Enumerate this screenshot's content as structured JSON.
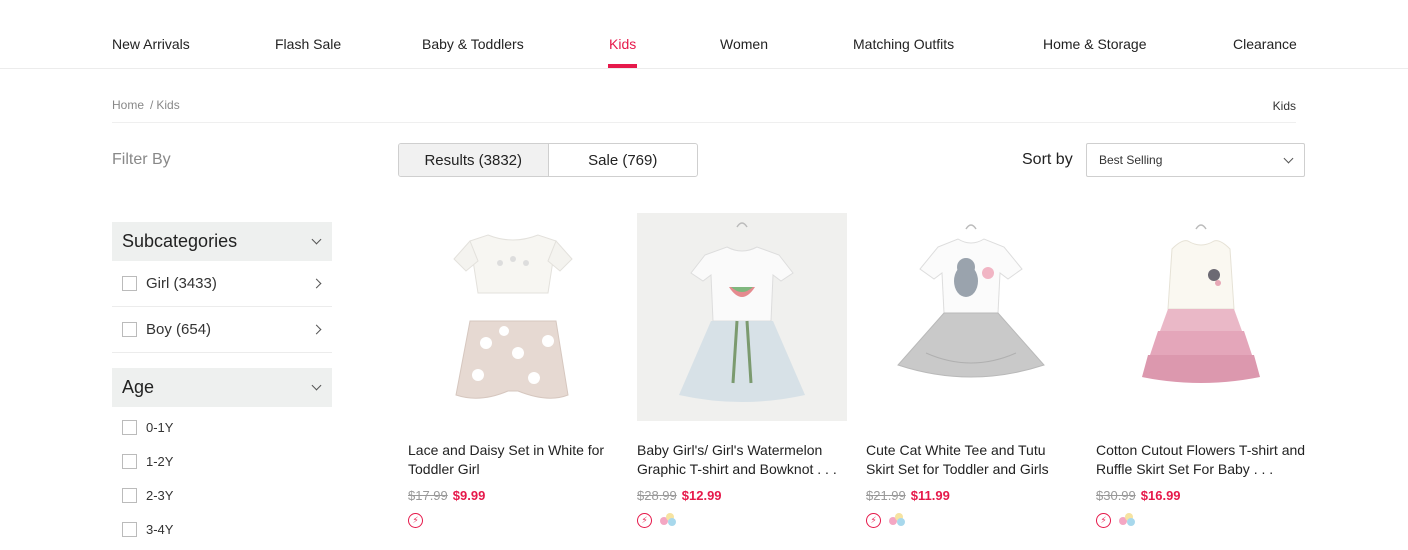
{
  "nav": {
    "items": [
      {
        "label": "New Arrivals"
      },
      {
        "label": "Flash Sale"
      },
      {
        "label": "Baby & Toddlers"
      },
      {
        "label": "Kids",
        "active": true
      },
      {
        "label": "Women"
      },
      {
        "label": "Matching Outfits"
      },
      {
        "label": "Home & Storage"
      },
      {
        "label": "Clearance"
      }
    ]
  },
  "breadcrumb": {
    "home": "Home",
    "separator": "/",
    "current": "Kids",
    "right_label": "Kids"
  },
  "filter_label": "Filter By",
  "tabs": [
    {
      "label": "Results (3832)",
      "active": true
    },
    {
      "label": "Sale (769)"
    }
  ],
  "sort": {
    "label": "Sort by",
    "selected": "Best Selling"
  },
  "sidebar": {
    "subcategories": {
      "title": "Subcategories",
      "items": [
        {
          "label": "Girl (3433)"
        },
        {
          "label": "Boy (654)"
        }
      ]
    },
    "age": {
      "title": "Age",
      "items": [
        {
          "label": "0-1Y"
        },
        {
          "label": "1-2Y"
        },
        {
          "label": "2-3Y"
        },
        {
          "label": "3-4Y"
        }
      ]
    }
  },
  "products": [
    {
      "name": "Lace and Daisy Set in White for Toddler Girl",
      "old_price": "$17.99",
      "price": "$9.99"
    },
    {
      "name": "Baby Girl's/ Girl's Watermelon Graphic T-shirt and Bowknot . . .",
      "old_price": "$28.99",
      "price": "$12.99"
    },
    {
      "name": "Cute Cat White Tee and Tutu Skirt Set for Toddler and Girls",
      "old_price": "$21.99",
      "price": "$11.99"
    },
    {
      "name": "Cotton Cutout Flowers T-shirt and Ruffle Skirt Set For Baby . . .",
      "old_price": "$30.99",
      "price": "$16.99"
    }
  ],
  "colors": {
    "accent": "#e6194b",
    "dot_pink": "#f4a7c3",
    "dot_blue": "#a8d8ec",
    "dot_yellow": "#f6e3a1"
  },
  "icons": {
    "flash": "lightning-bolt",
    "colors": "color-dots",
    "dropdown": "chevron-down",
    "expand": "chevron-right"
  }
}
